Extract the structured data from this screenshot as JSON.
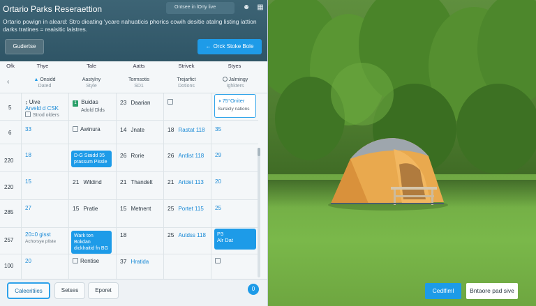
{
  "header": {
    "app_title": "Ortario Parks Reseraettion",
    "search_placeholder": "Ontsee in lOrty live",
    "subtitle": "Ortario powign in aleard: Stro dieating 'ycare nahuaticis phorics cowih desitie atalng listing iattion darks tratines = reaisitic laistres.",
    "guide_button": "Gudertse",
    "book_button": "Orck Stoke Bole"
  },
  "columns": {
    "headers": [
      "Ofk",
      "Thye",
      "Tale",
      "Aatts",
      "Strivek",
      "Styes"
    ],
    "subheaders": [
      {
        "line1": "Onsidd",
        "line2": "Dated"
      },
      {
        "line1": "Aastylny",
        "line2": "Style"
      },
      {
        "line1": "Tormsotis",
        "line2": "SD1"
      },
      {
        "line1": "Trejarfict",
        "line2": "Dotions"
      },
      {
        "line1": "Jalmingy",
        "line2": "Ighkters"
      }
    ]
  },
  "rows": {
    "labels": [
      "5",
      "6",
      "220",
      "220",
      "285",
      "257",
      "100"
    ],
    "r0": {
      "c1_title": "Uive",
      "c1_sub": "Arveld d CSK",
      "c1_extra": "Strod olders",
      "c2_title": "Buidas",
      "c2_sub": "Adold Dlds",
      "c3": "23",
      "c3_text": "Daarian",
      "c5_title": "75°Oniter",
      "c5_sub": "Sursicly nations"
    },
    "r1": {
      "c1": "33",
      "c2_text": "Awinura",
      "c3": "14",
      "c3_text": "Jnate",
      "c4": "18",
      "c4_text": "Rastat 118",
      "c5": "35"
    },
    "r2": {
      "c1": "18",
      "c2_chip": "D-G Siaidd 35 prassum Pissle",
      "c3": "26",
      "c3_text": "Rorie",
      "c4": "26",
      "c4_text": "Antlist 118",
      "c5": "29"
    },
    "r3": {
      "c1": "15",
      "c2": "21",
      "c2_text": "Wildind",
      "c3": "21",
      "c3_text": "Thandelt",
      "c4": "21",
      "c4_text": "Artdet 113",
      "c5": "20"
    },
    "r4": {
      "c1": "27",
      "c2": "15",
      "c2_text": "Pratie",
      "c3": "15",
      "c3_text": "Metnent",
      "c4": "25",
      "c4_text": "Portet 115",
      "c5": "25"
    },
    "r5": {
      "c1_title": "20=0 gisst",
      "c1_sub": "Achorsye pliste",
      "c2_chip": "Wark ton Bokdan dicklraitid fn BG",
      "c3": "18",
      "c4": "25",
      "c4_text": "Autdss 118",
      "c5_chip_title": "P3",
      "c5_chip_sub": "Alr Dat"
    },
    "r6": {
      "c1": "20",
      "c2_text": "Rentise",
      "c3": "37",
      "c3_text": "Hratida"
    }
  },
  "footer": {
    "btn1": "Caleeritiies",
    "btn2": "Setses",
    "btn3": "Eporet",
    "circle": "0"
  },
  "photo_actions": {
    "confirm": "Cedlfiml",
    "secondary": "Bntaore pad sive"
  },
  "colors": {
    "accent": "#1d9be8",
    "header_bg": "#2f5566"
  }
}
